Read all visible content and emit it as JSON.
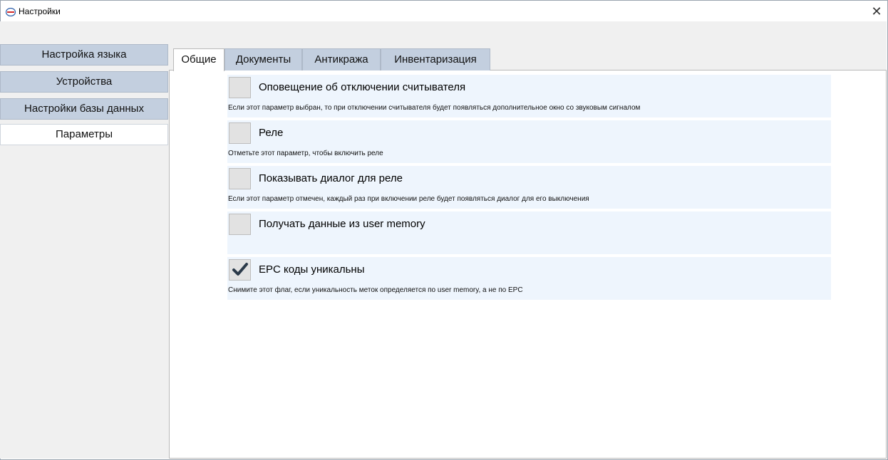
{
  "window": {
    "title": "Настройки",
    "close_glyph": "✕"
  },
  "sidebar": {
    "items": [
      {
        "label": "Настройка языка"
      },
      {
        "label": "Устройства"
      },
      {
        "label": "Настройки базы данных"
      },
      {
        "label": "Параметры",
        "active": true
      }
    ]
  },
  "tabs": [
    {
      "label": "Общие",
      "selected": true
    },
    {
      "label": "Документы"
    },
    {
      "label": "Антикража"
    },
    {
      "label": "Инвентаризация"
    }
  ],
  "options": [
    {
      "label": "Оповещение об отключении считывателя",
      "checked": false,
      "description": "Если этот параметр выбран, то при отключении считывателя будет появляться дополнительное окно со звуковым сигналом"
    },
    {
      "label": "Реле",
      "checked": false,
      "description": "Отметьте этот параметр, чтобы включить реле"
    },
    {
      "label": "Показывать диалог для реле",
      "checked": false,
      "description": "Если этот параметр отмечен, каждый раз при включении реле будет появляться диалог для его выключения"
    },
    {
      "label": "Получать данные из user memory",
      "checked": false,
      "description": ""
    },
    {
      "label": "EPC коды уникальны",
      "checked": true,
      "description": "Снимите этот флаг, если уникальность меток определяется по user memory, а не по EPC"
    }
  ],
  "colors": {
    "sidebar_button": "#c3cfdf",
    "tab_inactive": "#c3cfdf",
    "option_background": "#eef5fd",
    "checkmark": "#2b3a4a"
  }
}
